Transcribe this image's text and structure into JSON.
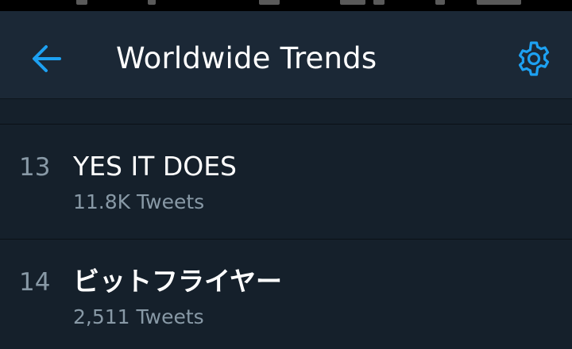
{
  "header": {
    "title": "Worldwide Trends",
    "back_icon": "arrow-left-icon",
    "settings_icon": "gear-icon"
  },
  "trends": [
    {
      "rank": "13",
      "name": "YES IT DOES",
      "tweets": "11.8K Tweets"
    },
    {
      "rank": "14",
      "name": "ビットフライヤー",
      "tweets": "2,511 Tweets"
    }
  ],
  "colors": {
    "background": "#15202b",
    "app_bar": "#1b2836",
    "accent": "#1da1f2",
    "secondary_text": "#8899a6",
    "primary_text": "#ffffff"
  }
}
